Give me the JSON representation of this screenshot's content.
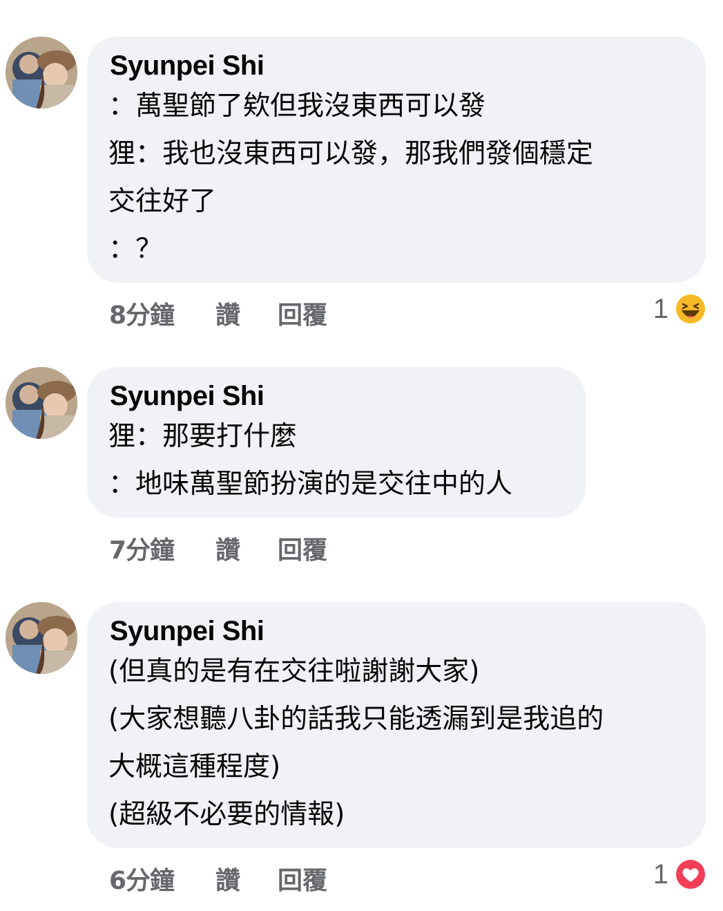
{
  "comments": [
    {
      "author": "Syunpei Shi",
      "lines": [
        "：萬聖節了欸但我沒東西可以發",
        "狸：我也沒東西可以發，那我們發個穩定",
        "交往好了",
        "：？"
      ],
      "time": "8分鐘",
      "like_label": "讚",
      "reply_label": "回覆",
      "reaction": {
        "count": "1",
        "icon": "laugh-emoji-icon",
        "color": "#f7b928"
      }
    },
    {
      "author": "Syunpei Shi",
      "lines": [
        "狸：那要打什麼",
        "：地味萬聖節扮演的是交往中的人"
      ],
      "time": "7分鐘",
      "like_label": "讚",
      "reply_label": "回覆"
    },
    {
      "author": "Syunpei Shi",
      "lines": [
        "(但真的是有在交往啦謝謝大家)",
        "(大家想聽八卦的話我只能透漏到是我追的",
        "大概這種程度)",
        "(超級不必要的情報)"
      ],
      "time": "6分鐘",
      "like_label": "讚",
      "reply_label": "回覆",
      "reaction": {
        "count": "1",
        "icon": "love-heart-icon",
        "color": "#f33e58"
      }
    }
  ],
  "colors": {
    "bubble": "#f0f2f5",
    "meta_text": "#65676b",
    "text": "#050505"
  }
}
